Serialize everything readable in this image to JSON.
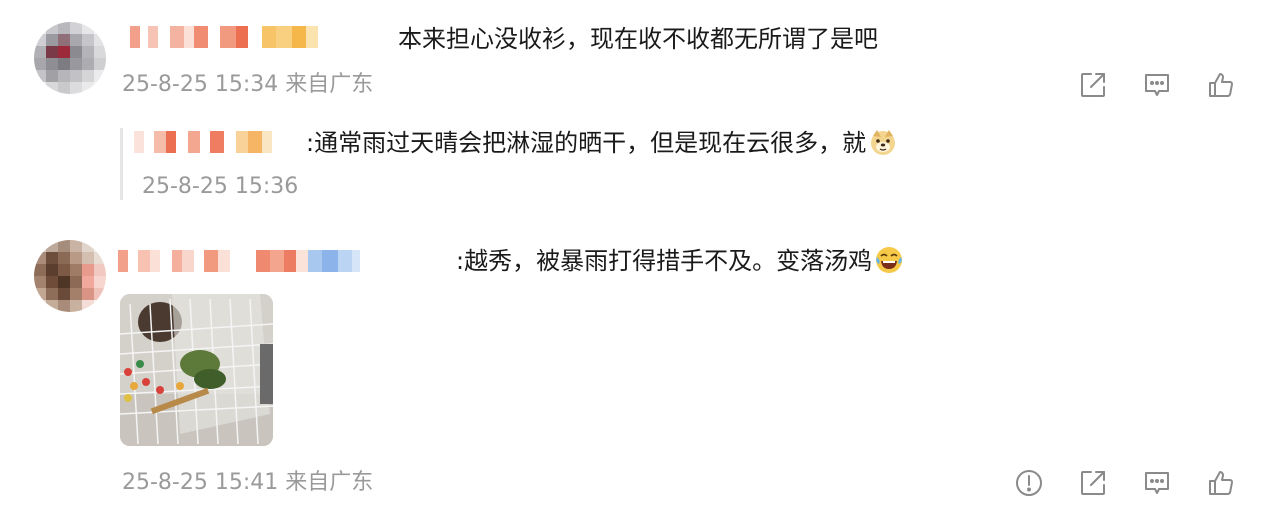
{
  "comments": [
    {
      "text": "本来担心没收衫，现在收不收都无所谓了是吧",
      "meta": "25-8-25 15:34 来自广东",
      "actions": [
        "share-icon",
        "comment-icon",
        "like-icon"
      ],
      "reply": {
        "text": ":通常雨过天晴会把淋湿的晒干，但是现在云很多，就",
        "emoji": "doge-emoji",
        "meta": "25-8-25 15:36"
      }
    },
    {
      "text": ":越秀，被暴雨打得措手不及。变落汤鸡",
      "emoji": "laughing-crying-emoji",
      "meta": "25-8-25 15:41 来自广东",
      "actions": [
        "report-icon",
        "share-icon",
        "comment-icon",
        "like-icon"
      ]
    }
  ],
  "colors": {
    "meta_gray": "#9a9a9a",
    "icon_gray": "#8a8a8a",
    "text": "#1a1a1a"
  }
}
